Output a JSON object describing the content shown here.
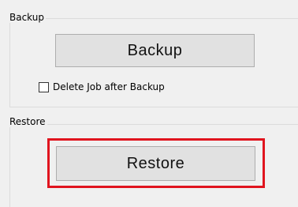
{
  "backup_group": {
    "title": "Backup",
    "button_label": "Backup",
    "delete_job": {
      "label": "Delete Job after Backup",
      "checked": false
    }
  },
  "restore_group": {
    "title": "Restore",
    "button_label": "Restore",
    "highlight_color": "#e0141e"
  }
}
